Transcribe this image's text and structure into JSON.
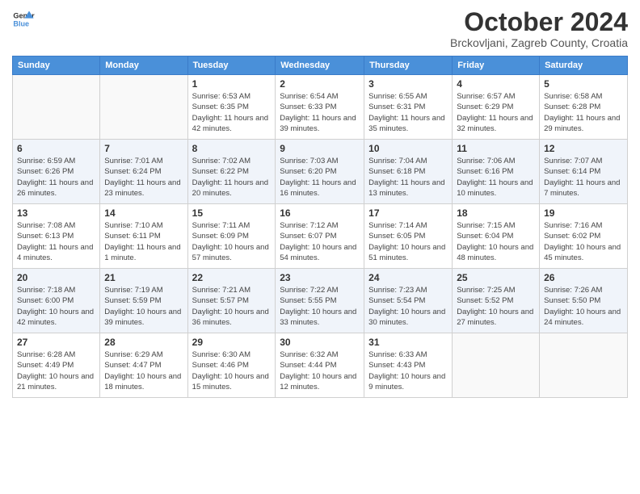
{
  "header": {
    "logo_line1": "General",
    "logo_line2": "Blue",
    "title": "October 2024",
    "subtitle": "Brckovljani, Zagreb County, Croatia"
  },
  "days_of_week": [
    "Sunday",
    "Monday",
    "Tuesday",
    "Wednesday",
    "Thursday",
    "Friday",
    "Saturday"
  ],
  "weeks": [
    [
      {
        "day": "",
        "info": ""
      },
      {
        "day": "",
        "info": ""
      },
      {
        "day": "1",
        "info": "Sunrise: 6:53 AM\nSunset: 6:35 PM\nDaylight: 11 hours and 42 minutes."
      },
      {
        "day": "2",
        "info": "Sunrise: 6:54 AM\nSunset: 6:33 PM\nDaylight: 11 hours and 39 minutes."
      },
      {
        "day": "3",
        "info": "Sunrise: 6:55 AM\nSunset: 6:31 PM\nDaylight: 11 hours and 35 minutes."
      },
      {
        "day": "4",
        "info": "Sunrise: 6:57 AM\nSunset: 6:29 PM\nDaylight: 11 hours and 32 minutes."
      },
      {
        "day": "5",
        "info": "Sunrise: 6:58 AM\nSunset: 6:28 PM\nDaylight: 11 hours and 29 minutes."
      }
    ],
    [
      {
        "day": "6",
        "info": "Sunrise: 6:59 AM\nSunset: 6:26 PM\nDaylight: 11 hours and 26 minutes."
      },
      {
        "day": "7",
        "info": "Sunrise: 7:01 AM\nSunset: 6:24 PM\nDaylight: 11 hours and 23 minutes."
      },
      {
        "day": "8",
        "info": "Sunrise: 7:02 AM\nSunset: 6:22 PM\nDaylight: 11 hours and 20 minutes."
      },
      {
        "day": "9",
        "info": "Sunrise: 7:03 AM\nSunset: 6:20 PM\nDaylight: 11 hours and 16 minutes."
      },
      {
        "day": "10",
        "info": "Sunrise: 7:04 AM\nSunset: 6:18 PM\nDaylight: 11 hours and 13 minutes."
      },
      {
        "day": "11",
        "info": "Sunrise: 7:06 AM\nSunset: 6:16 PM\nDaylight: 11 hours and 10 minutes."
      },
      {
        "day": "12",
        "info": "Sunrise: 7:07 AM\nSunset: 6:14 PM\nDaylight: 11 hours and 7 minutes."
      }
    ],
    [
      {
        "day": "13",
        "info": "Sunrise: 7:08 AM\nSunset: 6:13 PM\nDaylight: 11 hours and 4 minutes."
      },
      {
        "day": "14",
        "info": "Sunrise: 7:10 AM\nSunset: 6:11 PM\nDaylight: 11 hours and 1 minute."
      },
      {
        "day": "15",
        "info": "Sunrise: 7:11 AM\nSunset: 6:09 PM\nDaylight: 10 hours and 57 minutes."
      },
      {
        "day": "16",
        "info": "Sunrise: 7:12 AM\nSunset: 6:07 PM\nDaylight: 10 hours and 54 minutes."
      },
      {
        "day": "17",
        "info": "Sunrise: 7:14 AM\nSunset: 6:05 PM\nDaylight: 10 hours and 51 minutes."
      },
      {
        "day": "18",
        "info": "Sunrise: 7:15 AM\nSunset: 6:04 PM\nDaylight: 10 hours and 48 minutes."
      },
      {
        "day": "19",
        "info": "Sunrise: 7:16 AM\nSunset: 6:02 PM\nDaylight: 10 hours and 45 minutes."
      }
    ],
    [
      {
        "day": "20",
        "info": "Sunrise: 7:18 AM\nSunset: 6:00 PM\nDaylight: 10 hours and 42 minutes."
      },
      {
        "day": "21",
        "info": "Sunrise: 7:19 AM\nSunset: 5:59 PM\nDaylight: 10 hours and 39 minutes."
      },
      {
        "day": "22",
        "info": "Sunrise: 7:21 AM\nSunset: 5:57 PM\nDaylight: 10 hours and 36 minutes."
      },
      {
        "day": "23",
        "info": "Sunrise: 7:22 AM\nSunset: 5:55 PM\nDaylight: 10 hours and 33 minutes."
      },
      {
        "day": "24",
        "info": "Sunrise: 7:23 AM\nSunset: 5:54 PM\nDaylight: 10 hours and 30 minutes."
      },
      {
        "day": "25",
        "info": "Sunrise: 7:25 AM\nSunset: 5:52 PM\nDaylight: 10 hours and 27 minutes."
      },
      {
        "day": "26",
        "info": "Sunrise: 7:26 AM\nSunset: 5:50 PM\nDaylight: 10 hours and 24 minutes."
      }
    ],
    [
      {
        "day": "27",
        "info": "Sunrise: 6:28 AM\nSunset: 4:49 PM\nDaylight: 10 hours and 21 minutes."
      },
      {
        "day": "28",
        "info": "Sunrise: 6:29 AM\nSunset: 4:47 PM\nDaylight: 10 hours and 18 minutes."
      },
      {
        "day": "29",
        "info": "Sunrise: 6:30 AM\nSunset: 4:46 PM\nDaylight: 10 hours and 15 minutes."
      },
      {
        "day": "30",
        "info": "Sunrise: 6:32 AM\nSunset: 4:44 PM\nDaylight: 10 hours and 12 minutes."
      },
      {
        "day": "31",
        "info": "Sunrise: 6:33 AM\nSunset: 4:43 PM\nDaylight: 10 hours and 9 minutes."
      },
      {
        "day": "",
        "info": ""
      },
      {
        "day": "",
        "info": ""
      }
    ]
  ]
}
